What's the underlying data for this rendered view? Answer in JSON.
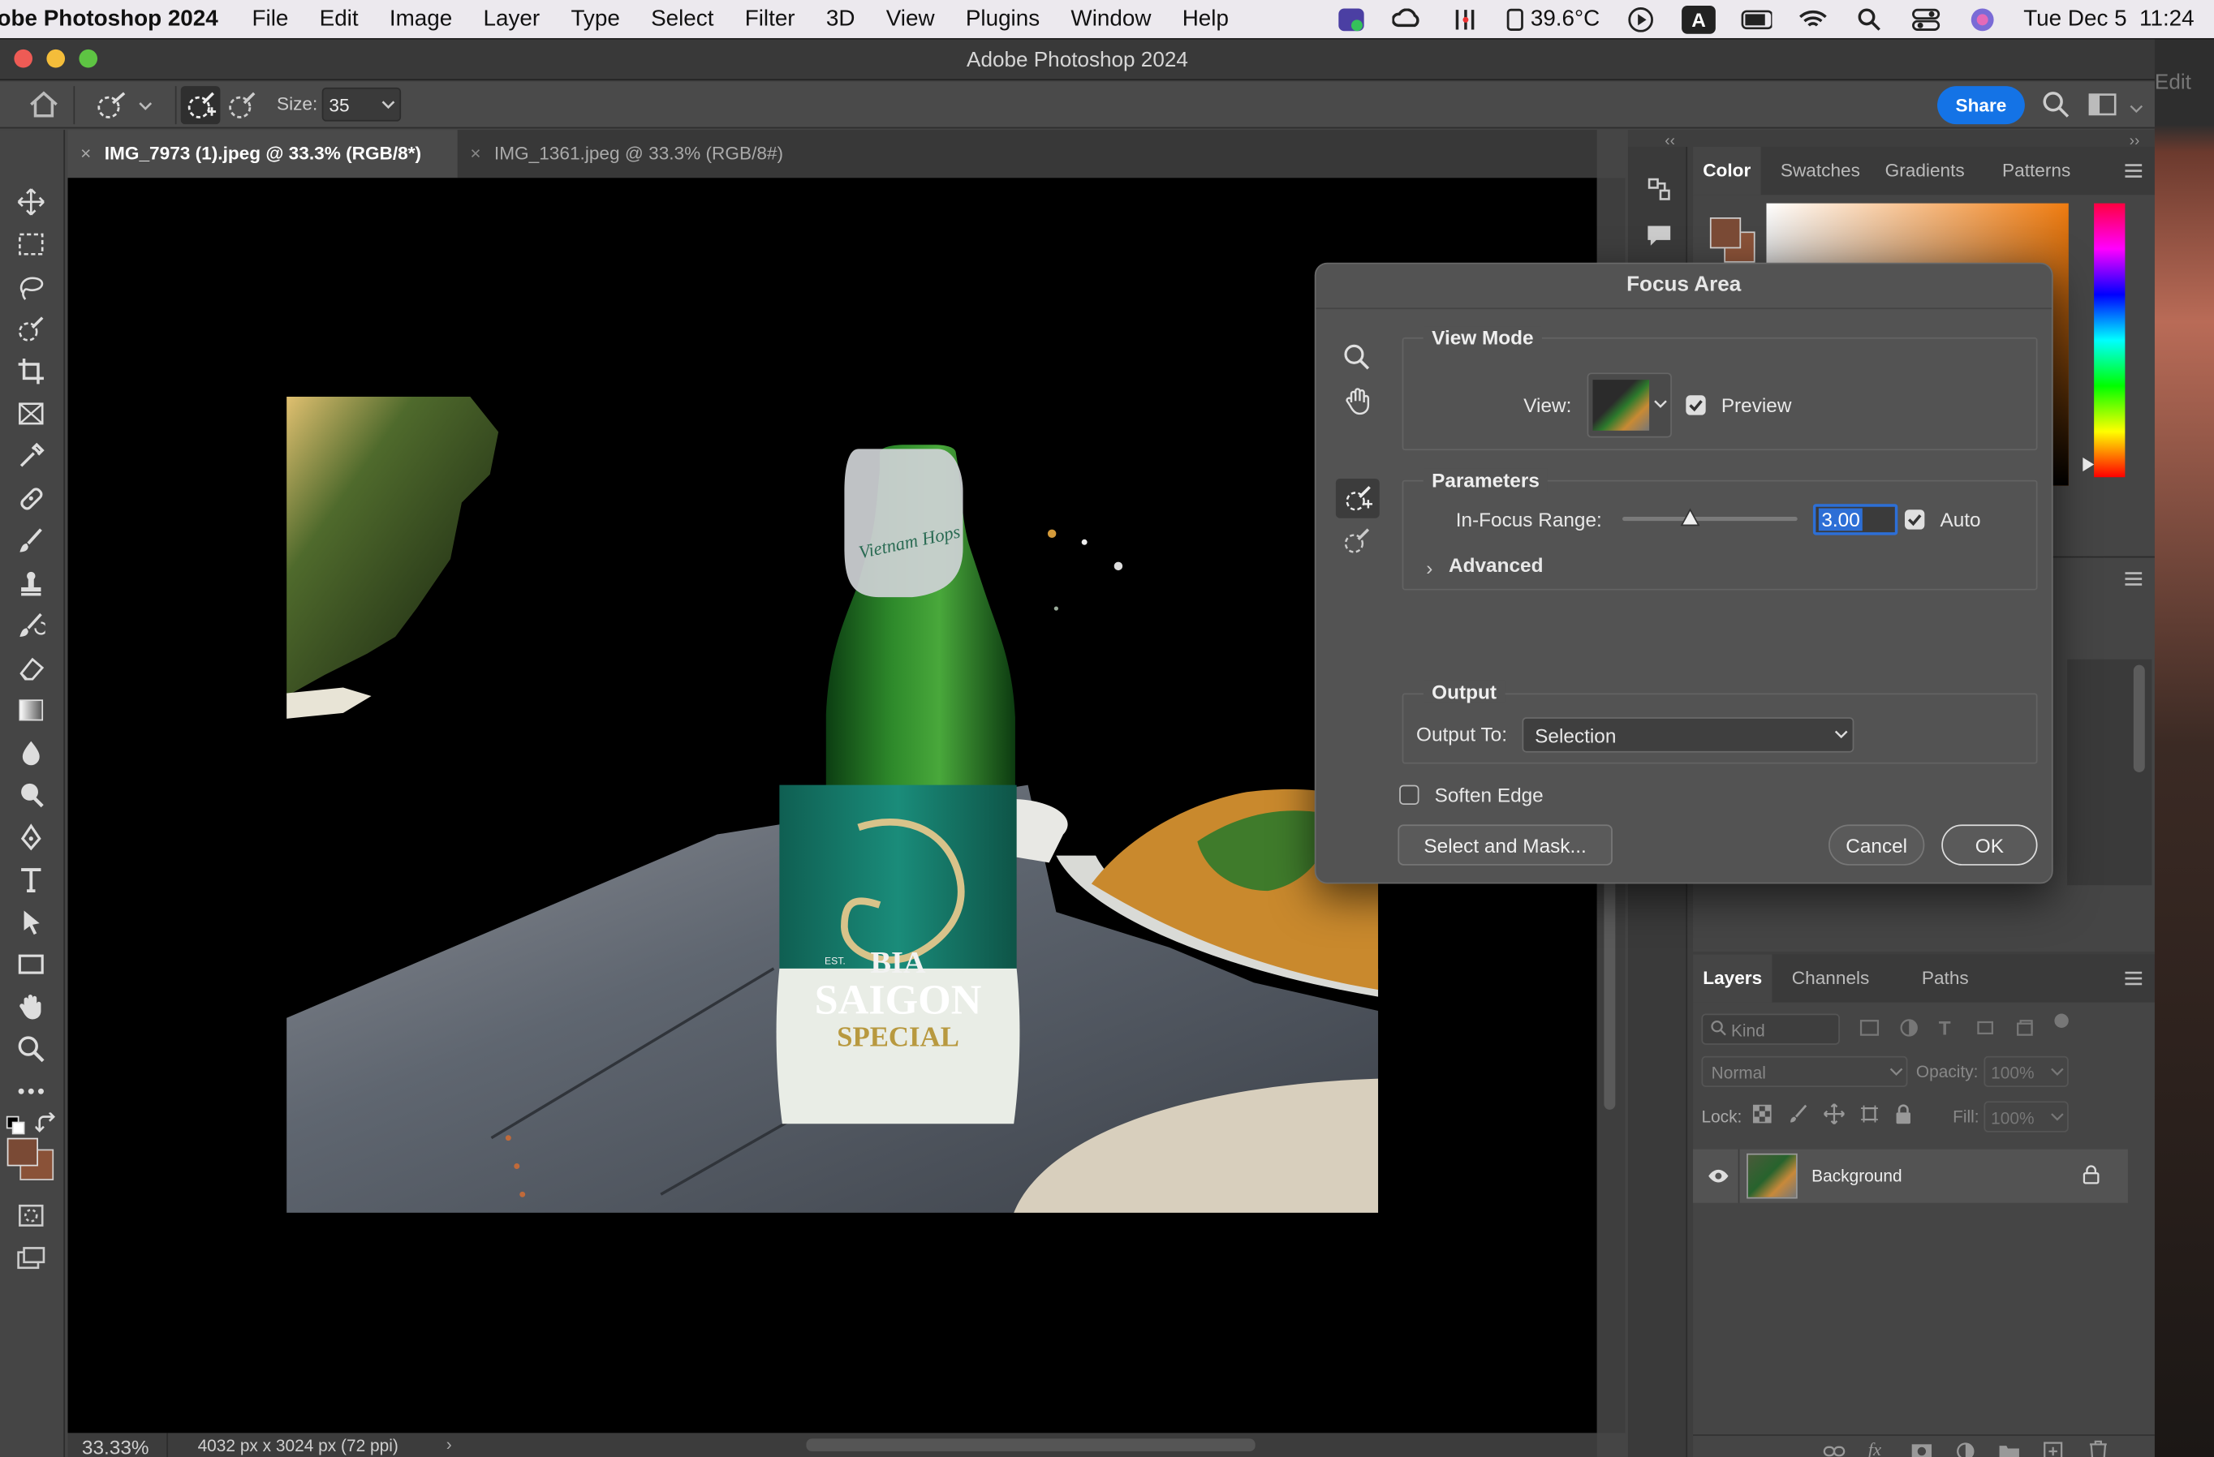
{
  "menubar": {
    "app": "obe Photoshop 2024",
    "items": [
      "File",
      "Edit",
      "Image",
      "Layer",
      "Type",
      "Select",
      "Filter",
      "3D",
      "View",
      "Plugins",
      "Window",
      "Help"
    ],
    "temperature": "39.6°C",
    "keyboard": "A",
    "datetime": "Tue Dec 5  11:24"
  },
  "window": {
    "title": "Adobe Photoshop 2024",
    "edit_partial": "Edit"
  },
  "options": {
    "size_label": "Size:",
    "size_value": "35",
    "share": "Share"
  },
  "tabs": [
    {
      "label": "IMG_7973 (1).jpeg @ 33.3% (RGB/8*)",
      "active": true
    },
    {
      "label": "IMG_1361.jpeg @ 33.3% (RGB/8#)",
      "active": false
    }
  ],
  "status": {
    "zoom": "33.33%",
    "dimensions": "4032 px x 3024 px (72 ppi)"
  },
  "color_panel": {
    "tabs": [
      "Color",
      "Swatches",
      "Gradients",
      "Patterns"
    ],
    "foreground": "#7a4a35",
    "background": "#8a5238"
  },
  "layers_panel": {
    "tabs": [
      "Layers",
      "Channels",
      "Paths"
    ],
    "kind_placeholder": "Kind",
    "blend_mode": "Normal",
    "opacity_label": "Opacity:",
    "opacity_value": "100%",
    "lock_label": "Lock:",
    "fill_label": "Fill:",
    "fill_value": "100%",
    "layers": [
      {
        "name": "Background"
      }
    ]
  },
  "dialog": {
    "title": "Focus Area",
    "view_mode_label": "View Mode",
    "view_label": "View:",
    "preview_label": "Preview",
    "preview_checked": true,
    "parameters_label": "Parameters",
    "in_focus_label": "In-Focus Range:",
    "in_focus_value": "3.00",
    "in_focus_fraction": 0.39,
    "auto_label": "Auto",
    "auto_checked": true,
    "advanced_label": "Advanced",
    "output_label": "Output",
    "output_to_label": "Output To:",
    "output_to_value": "Selection",
    "soften_edge_label": "Soften Edge",
    "soften_edge_checked": false,
    "select_and_mask": "Select and Mask...",
    "cancel": "Cancel",
    "ok": "OK"
  },
  "photo_label": {
    "brand_top": "BIA",
    "brand_main": "SAIGON",
    "brand_sub": "SPECIAL",
    "cap_script": "Vietnam Hops",
    "est": "EST."
  }
}
